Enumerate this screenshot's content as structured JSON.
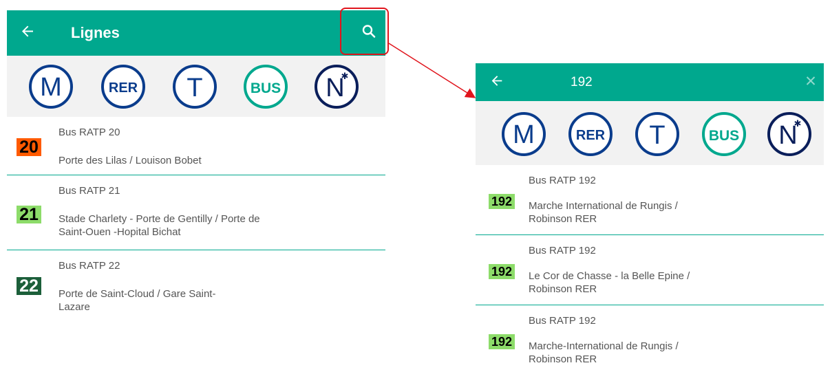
{
  "left_screen": {
    "title": "Lignes",
    "lines": [
      {
        "number": "20",
        "name": "Bus RATP 20",
        "route": "Porte des Lilas / Louison Bobet",
        "badge_bg": "#ff5a00",
        "badge_fg": "#000000"
      },
      {
        "number": "21",
        "name": "Bus RATP 21",
        "route": "Stade Charlety - Porte de Gentilly / Porte de Saint-Ouen -Hopital Bichat",
        "badge_bg": "#8ddc6a",
        "badge_fg": "#000000"
      },
      {
        "number": "22",
        "name": "Bus RATP 22",
        "route": "Porte de Saint-Cloud / Gare Saint-Lazare",
        "badge_bg": "#1c5f3a",
        "badge_fg": "#ffffff"
      }
    ]
  },
  "right_screen": {
    "query": "192",
    "results": [
      {
        "number": "192",
        "name": "Bus RATP 192",
        "route": "Marche International de Rungis / Robinson RER",
        "badge_bg": "#8ddc6a",
        "badge_fg": "#000000"
      },
      {
        "number": "192",
        "name": "Bus RATP 192",
        "route": "Le Cor de Chasse - la Belle Epine / Robinson RER",
        "badge_bg": "#8ddc6a",
        "badge_fg": "#000000"
      },
      {
        "number": "192",
        "name": "Bus RATP 192",
        "route": "Marche-International de Rungis / Robinson RER",
        "badge_bg": "#8ddc6a",
        "badge_fg": "#000000"
      }
    ]
  },
  "modes": [
    {
      "id": "metro",
      "label": "M",
      "color": "#0a3c8c"
    },
    {
      "id": "rer",
      "label": "RER",
      "color": "#0a3c8c"
    },
    {
      "id": "tram",
      "label": "T",
      "color": "#0a3c8c"
    },
    {
      "id": "bus",
      "label": "BUS",
      "color": "#00a88e"
    },
    {
      "id": "noctilien",
      "label": "N",
      "color": "#0a1e5a"
    }
  ],
  "colors": {
    "app_bar": "#00a88e",
    "highlight": "#e0141c",
    "divider": "#00a88e"
  },
  "icons": {
    "back": "arrow-left-icon",
    "search": "search-icon",
    "clear": "close-icon"
  }
}
